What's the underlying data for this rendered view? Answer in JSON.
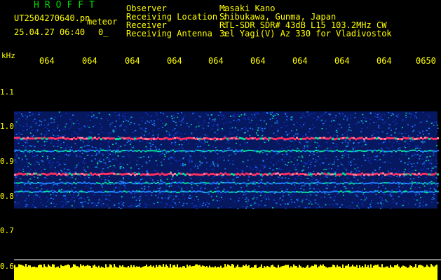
{
  "header": {
    "app_title": "HROFFT",
    "file_name": "UT2504270640.pn",
    "meteor_tag": "meteor",
    "datetime": "25.04.27 06:40",
    "counter": "0_",
    "info_labels": "Observer           : \nReceiving Location : \nReceiver           : \nReceiving Antenna  : ",
    "info_values": "Masaki Kano\nShibukawa, Gunma, Japan\nRTL-SDR SDR# 43dB L15 103.2MHz CW\n3el Yagi(V) Az 330 for Vladivostok"
  },
  "axes": {
    "freq_unit": "kHz",
    "time_ticks": [
      "064",
      "064",
      "064",
      "064",
      "064",
      "064",
      "064",
      "064",
      "064",
      "0650"
    ],
    "freq_ticks": [
      "1.1",
      "1.0",
      "0.9",
      "0.8",
      "0.7",
      "0.6"
    ]
  },
  "colors": {
    "text": "#ffff00",
    "title": "#00dd00",
    "background": "#000000",
    "band_strong": "#ff3060",
    "band_mid": "#00e0a0",
    "noise_low": "#1030c0",
    "noise_mid": "#2080ff",
    "power_bar": "#ffff00"
  },
  "spectrum": {
    "band_freqs_khz": [
      0.965,
      0.928,
      0.862,
      0.835,
      0.81
    ],
    "band_strength": [
      1.0,
      0.55,
      1.0,
      0.35,
      0.3
    ],
    "noise_range_khz": [
      0.76,
      1.04
    ]
  }
}
